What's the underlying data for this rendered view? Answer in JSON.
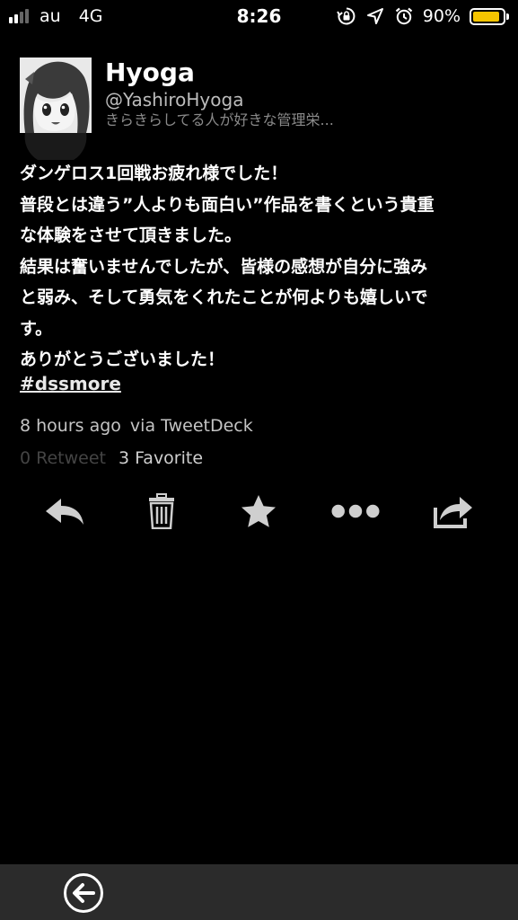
{
  "status_bar": {
    "carrier": "au",
    "network": "4G",
    "time": "8:26",
    "battery_percent": "90%",
    "battery_level": 0.9,
    "signal_bars_filled": 2,
    "icons": [
      "orientation-lock-icon",
      "location-arrow-icon",
      "alarm-icon",
      "battery-icon"
    ],
    "battery_color": "#f5c400"
  },
  "profile": {
    "name": "Hyoga",
    "handle": "@YashiroHyoga",
    "bio": "きらきらしてる人が好きな管理栄..."
  },
  "tweet": {
    "lines": [
      "ダンゲロス1回戦お疲れ様でした！",
      "普段とは違う”人よりも面白い”作品を書くという貴重",
      "な体験をさせて頂きました。",
      "結果は奮いませんでしたが、皆様の感想が自分に強み",
      "と弱み、そして勇気をくれたことが何よりも嬉しいで",
      "す。",
      "ありがとうございました！"
    ],
    "hashtag": "#dssmore",
    "time_ago": "8 hours ago",
    "via": "via TweetDeck",
    "retweets": "0 Retweet",
    "favorites": "3 Favorite"
  },
  "actions": [
    "reply-icon",
    "delete-icon",
    "favorite-icon",
    "more-icon",
    "share-icon"
  ],
  "toolbar": {
    "back": "back-icon"
  }
}
